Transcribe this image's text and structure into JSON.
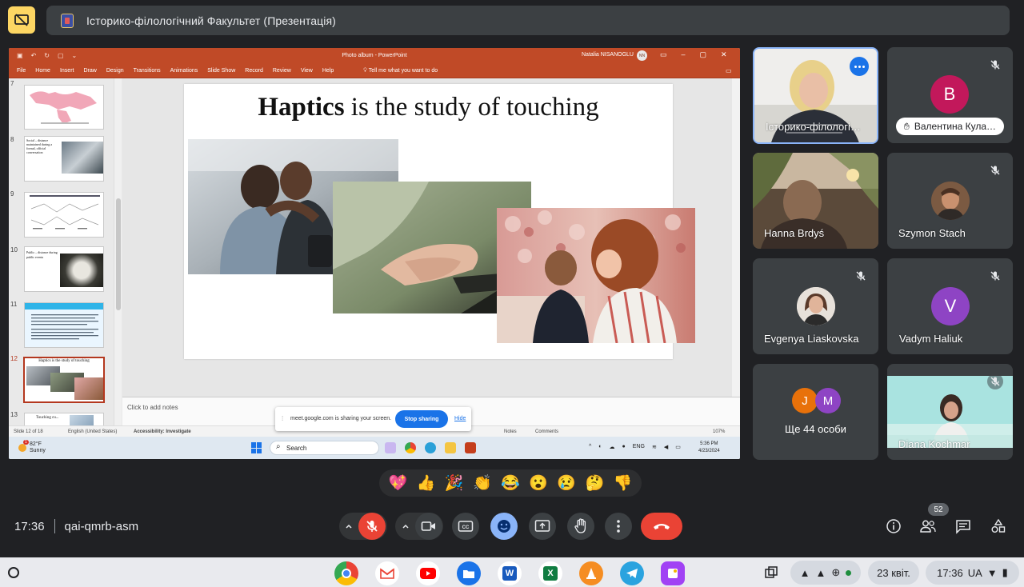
{
  "meeting": {
    "title": "Історико-філологічний Факультет (Презентація)",
    "time": "17:36",
    "code": "qai-qmrb-asm",
    "people_count": "52"
  },
  "ppt": {
    "window_title": "Photo album  -  PowerPoint",
    "user_name": "Natalia NISANOGLU",
    "user_initials": "NN",
    "tabs": [
      "File",
      "Home",
      "Insert",
      "Draw",
      "Design",
      "Transitions",
      "Animations",
      "Slide Show",
      "Record",
      "Review",
      "View",
      "Help"
    ],
    "tell_me": "Tell me what you want to do",
    "slide_title_bold": "Haptics",
    "slide_title_rest": " is the study of touching",
    "notes_placeholder": "Click to add notes",
    "thumbnails": [
      {
        "num": "7",
        "text": ""
      },
      {
        "num": "8",
        "text": "Social – distance maintained during a formal, official conversation"
      },
      {
        "num": "9",
        "text": ""
      },
      {
        "num": "10",
        "text": "Public – distance during public events"
      },
      {
        "num": "11",
        "text": ""
      },
      {
        "num": "12",
        "text": "Haptics is the study of touching"
      },
      {
        "num": "13",
        "text": "Touching cu..."
      }
    ],
    "status": {
      "slide_of": "Slide 12 of 18",
      "language": "English (United States)",
      "accessibility": "Accessibility: Investigate",
      "notes": "Notes",
      "comments": "Comments",
      "zoom": "107%"
    }
  },
  "share_notice": {
    "message": "meet.google.com is sharing your screen.",
    "stop_label": "Stop sharing",
    "hide_label": "Hide"
  },
  "windows_taskbar": {
    "temperature": "82°F",
    "weather": "Sunny",
    "search": "Search",
    "lang": "ENG",
    "time": "5:36 PM",
    "date": "4/23/2024"
  },
  "participants": {
    "presenter": "Історико-філологі…",
    "valentyna": {
      "initial": "B",
      "name": "Валентина Кула…",
      "color": "#c2185b"
    },
    "hanna": "Hanna Brdyś",
    "szymon": "Szymon Stach",
    "evgenya": "Evgenya Liaskovska",
    "vadym": {
      "initial": "V",
      "name": "Vadym Haliuk",
      "color": "#8e44c4"
    },
    "others": {
      "label": "Ще 44 особи",
      "a": "J",
      "b": "M"
    },
    "diana": "Diana Kochmar"
  },
  "reactions": [
    "💖",
    "👍",
    "🎉",
    "👏",
    "😂",
    "😮",
    "😢",
    "🤔",
    "👎"
  ],
  "shelf": {
    "date": "23 квіт.",
    "time": "17:36",
    "lang": "UA"
  }
}
